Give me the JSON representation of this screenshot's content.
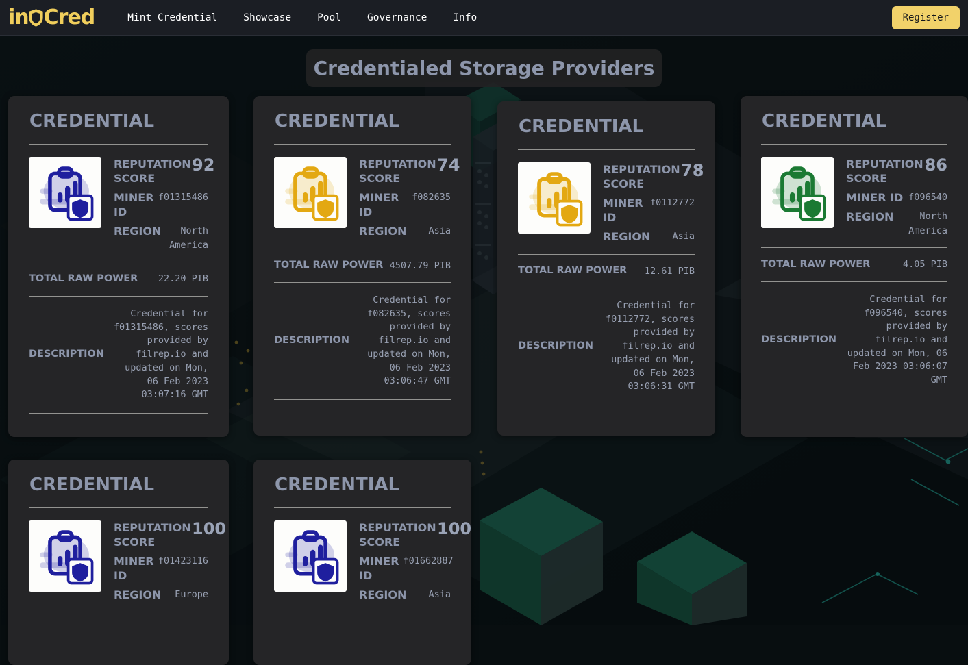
{
  "header": {
    "logo": {
      "prefix": "in",
      "icon": "shield-icon",
      "suffix": "Cred",
      "color": "#f0ce5c"
    },
    "nav": [
      {
        "label": "Mint Credential"
      },
      {
        "label": "Showcase"
      },
      {
        "label": "Pool"
      },
      {
        "label": "Governance"
      },
      {
        "label": "Info"
      }
    ],
    "register_label": "Register",
    "register_color": "#f2d26a",
    "bar_color": "#1b1e24"
  },
  "page": {
    "title": "Credentialed Storage Providers",
    "title_color": "#8d96ab",
    "background_color": "#080e10"
  },
  "labels": {
    "card_title": "CREDENTIAL",
    "reputation_score": "REPUTATION SCORE",
    "miner_id": "MINER ID",
    "region": "REGION",
    "total_raw_power": "TOTAL RAW POWER",
    "description": "DESCRIPTION"
  },
  "cards": [
    {
      "title": "CREDENTIAL",
      "icon": "credential-clipboard-shield-icon",
      "icon_color": "#1f1f9e",
      "reputation_score": "92",
      "miner_id": "f01315486",
      "region": "North America",
      "total_raw_power": "22.20 PIB",
      "description": "Credential for f01315486, scores provided by filrep.io and updated on Mon, 06 Feb 2023 03:07:16 GMT"
    },
    {
      "title": "CREDENTIAL",
      "icon": "credential-clipboard-shield-icon",
      "icon_color": "#e3a812",
      "reputation_score": "74",
      "miner_id": "f082635",
      "region": "Asia",
      "total_raw_power": "4507.79 PIB",
      "description": "Credential for f082635, scores provided by filrep.io and updated on Mon, 06 Feb 2023 03:06:47 GMT"
    },
    {
      "title": "CREDENTIAL",
      "icon": "credential-clipboard-shield-icon",
      "icon_color": "#e3a812",
      "reputation_score": "78",
      "miner_id": "f0112772",
      "region": "Asia",
      "total_raw_power": "12.61 PIB",
      "description": "Credential for f0112772, scores provided by filrep.io and updated on Mon, 06 Feb 2023 03:06:31 GMT"
    },
    {
      "title": "CREDENTIAL",
      "icon": "credential-clipboard-shield-icon",
      "icon_color": "#1b7a33",
      "reputation_score": "86",
      "miner_id": "f096540",
      "region": "North America",
      "total_raw_power": "4.05 PIB",
      "description": "Credential for f096540, scores provided by filrep.io and updated on Mon, 06 Feb 2023 03:06:07 GMT"
    },
    {
      "title": "CREDENTIAL",
      "icon": "credential-clipboard-shield-icon",
      "icon_color": "#1f1f9e",
      "reputation_score": "100",
      "miner_id": "f01423116",
      "region": "Europe",
      "total_raw_power": "",
      "description": ""
    },
    {
      "title": "CREDENTIAL",
      "icon": "credential-clipboard-shield-icon",
      "icon_color": "#1f1f9e",
      "reputation_score": "100",
      "miner_id": "f01662887",
      "region": "Asia",
      "total_raw_power": "",
      "description": ""
    }
  ]
}
